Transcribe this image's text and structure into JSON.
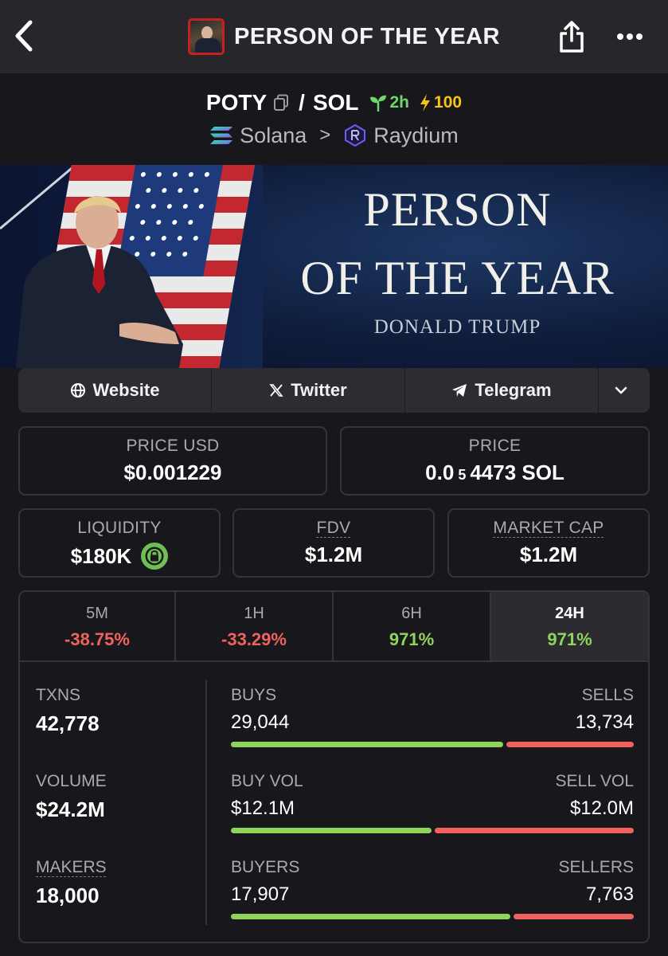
{
  "header": {
    "title": "PERSON OF THE YEAR",
    "back_icon": "chevron-left-icon",
    "share_icon": "share-icon",
    "more_icon": "more-horizontal-icon"
  },
  "pair": {
    "base": "POTY",
    "slash": "/",
    "quote": "SOL",
    "age": "2h",
    "boost": "100",
    "chain": "Solana",
    "dex": "Raydium",
    "chain_separator": ">"
  },
  "banner": {
    "line1": "PERSON",
    "line2": "OF THE YEAR",
    "line3": "DONALD TRUMP"
  },
  "links": {
    "website": "Website",
    "twitter": "Twitter",
    "telegram": "Telegram"
  },
  "prices": {
    "usd_label": "PRICE USD",
    "usd_value": "$0.001229",
    "native_label": "PRICE",
    "native_prefix": "0.0",
    "native_zeros": "5",
    "native_digits": "4473 SOL"
  },
  "metrics": {
    "liquidity_label": "LIQUIDITY",
    "liquidity_value": "$180K",
    "fdv_label": "FDV",
    "fdv_value": "$1.2M",
    "mcap_label": "MARKET CAP",
    "mcap_value": "$1.2M"
  },
  "timeframes": [
    {
      "label": "5M",
      "value": "-38.75%"
    },
    {
      "label": "1H",
      "value": "-33.29%"
    },
    {
      "label": "6H",
      "value": "971%"
    },
    {
      "label": "24H",
      "value": "971%"
    }
  ],
  "stats": {
    "txns_label": "TXNS",
    "txns_value": "42,778",
    "volume_label": "VOLUME",
    "volume_value": "$24.2M",
    "makers_label": "MAKERS",
    "makers_value": "18,000",
    "buys_label": "BUYS",
    "buys_value": "29,044",
    "sells_label": "SELLS",
    "sells_value": "13,734",
    "buyvol_label": "BUY VOL",
    "buyvol_value": "$12.1M",
    "sellvol_label": "SELL VOL",
    "sellvol_value": "$12.0M",
    "buyers_label": "BUYERS",
    "buyers_value": "17,907",
    "sellers_label": "SELLERS",
    "sellers_value": "7,763",
    "buys_share": 0.68,
    "buyvol_share": 0.502,
    "buyers_share": 0.698
  },
  "colors": {
    "positive": "#8fd35b",
    "negative": "#f0625d",
    "background": "#17171c",
    "header_bg": "#26262b"
  }
}
